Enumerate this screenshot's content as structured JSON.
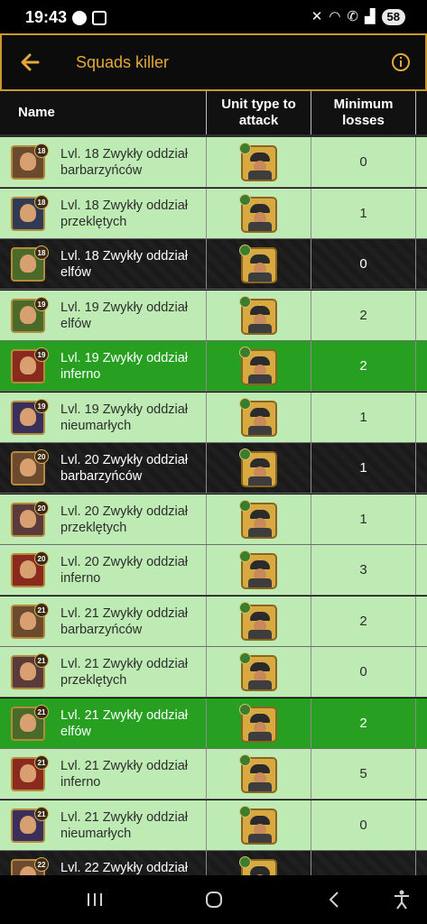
{
  "status": {
    "time": "19:43",
    "battery": "58"
  },
  "header": {
    "title": "Squads killer"
  },
  "table": {
    "columns": {
      "name": "Name",
      "unit_type": "Unit type to attack",
      "losses": "Minimum losses"
    },
    "rows": [
      {
        "level": "18",
        "name": "Lvl. 18 Zwykły oddział barbarzyńców",
        "losses": "0",
        "style": "light",
        "avatar_color": "#6b4a2e"
      },
      {
        "level": "18",
        "name": "Lvl. 18 Zwykły oddział przeklętych",
        "losses": "1",
        "style": "light",
        "avatar_color": "#2f3a55"
      },
      {
        "level": "18",
        "name": "Lvl. 18 Zwykły oddział elfów",
        "losses": "0",
        "style": "dark",
        "avatar_color": "#4a6a2a"
      },
      {
        "level": "19",
        "name": "Lvl. 19 Zwykły oddział elfów",
        "losses": "2",
        "style": "light",
        "avatar_color": "#4a6a2a"
      },
      {
        "level": "19",
        "name": "Lvl. 19 Zwykły oddział inferno",
        "losses": "2",
        "style": "green",
        "avatar_color": "#8a2a1e"
      },
      {
        "level": "19",
        "name": "Lvl. 19 Zwykły oddział nieumarłych",
        "losses": "1",
        "style": "light",
        "avatar_color": "#3a2e5a"
      },
      {
        "level": "20",
        "name": "Lvl. 20 Zwykły oddział barbarzyńców",
        "losses": "1",
        "style": "dark",
        "avatar_color": "#6b4a2e"
      },
      {
        "level": "20",
        "name": "Lvl. 20 Zwykły oddział przeklętych",
        "losses": "1",
        "style": "light",
        "avatar_color": "#5a3a3a"
      },
      {
        "level": "20",
        "name": "Lvl. 20 Zwykły oddział inferno",
        "losses": "3",
        "style": "light",
        "avatar_color": "#8a2a1e"
      },
      {
        "level": "21",
        "name": "Lvl. 21 Zwykły oddział barbarzyńców",
        "losses": "2",
        "style": "light",
        "avatar_color": "#6b4a2e"
      },
      {
        "level": "21",
        "name": "Lvl. 21 Zwykły oddział przeklętych",
        "losses": "0",
        "style": "light",
        "avatar_color": "#5a3a3a"
      },
      {
        "level": "21",
        "name": "Lvl. 21 Zwykły oddział elfów",
        "losses": "2",
        "style": "green",
        "avatar_color": "#4a6a2a"
      },
      {
        "level": "21",
        "name": "Lvl. 21 Zwykły oddział inferno",
        "losses": "5",
        "style": "light",
        "avatar_color": "#8a2a1e"
      },
      {
        "level": "21",
        "name": "Lvl. 21 Zwykły oddział nieumarłych",
        "losses": "0",
        "style": "light",
        "avatar_color": "#3a2e5a"
      },
      {
        "level": "22",
        "name": "Lvl. 22 Zwykły oddział",
        "losses": "",
        "style": "dark",
        "avatar_color": "#6b4a2e"
      }
    ]
  },
  "colors": {
    "accent": "#c9972a",
    "title": "#e2a93a",
    "row_light": "#bdebb3",
    "row_green": "#27a022"
  },
  "icons": {
    "back": "arrow-left-icon",
    "info": "info-icon",
    "nav_recents": "recents-icon",
    "nav_home": "home-icon",
    "nav_back": "back-icon",
    "nav_accessibility": "accessibility-icon"
  }
}
